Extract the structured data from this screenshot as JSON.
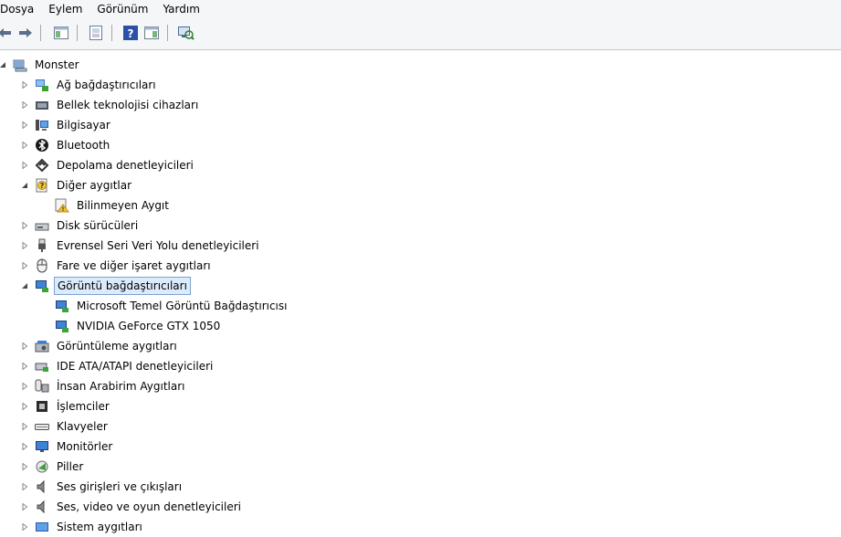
{
  "menubar": {
    "items": [
      "Dosya",
      "Eylem",
      "Görünüm",
      "Yardım"
    ]
  },
  "toolbar": {
    "buttons": [
      "back-arrow-icon",
      "forward-arrow-icon",
      "console-tree-icon",
      "properties-icon",
      "help-icon",
      "action-pane-icon",
      "scan-hardware-icon"
    ]
  },
  "tree": {
    "root": "Monster",
    "categories": [
      {
        "label": "Ağ bağdaştırıcıları",
        "icon": "network-adapter-icon",
        "expanded": false
      },
      {
        "label": "Bellek teknolojisi cihazları",
        "icon": "memory-device-icon",
        "expanded": false
      },
      {
        "label": "Bilgisayar",
        "icon": "computer-icon",
        "expanded": false
      },
      {
        "label": "Bluetooth",
        "icon": "bluetooth-icon",
        "expanded": false
      },
      {
        "label": "Depolama denetleyicileri",
        "icon": "storage-controller-icon",
        "expanded": false
      },
      {
        "label": "Diğer aygıtlar",
        "icon": "other-devices-icon",
        "expanded": true,
        "children": [
          {
            "label": "Bilinmeyen Aygıt",
            "icon": "unknown-device-warning-icon"
          }
        ]
      },
      {
        "label": "Disk sürücüleri",
        "icon": "disk-drive-icon",
        "expanded": false
      },
      {
        "label": "Evrensel Seri Veri Yolu denetleyicileri",
        "icon": "usb-icon",
        "expanded": false
      },
      {
        "label": "Fare ve diğer işaret aygıtları",
        "icon": "mouse-icon",
        "expanded": false
      },
      {
        "label": "Görüntü bağdaştırıcıları",
        "icon": "display-adapter-icon",
        "expanded": true,
        "selected": true,
        "children": [
          {
            "label": "Microsoft Temel Görüntü Bağdaştırıcısı",
            "icon": "display-adapter-icon"
          },
          {
            "label": "NVIDIA GeForce GTX 1050",
            "icon": "display-adapter-icon"
          }
        ]
      },
      {
        "label": "Görüntüleme aygıtları",
        "icon": "imaging-device-icon",
        "expanded": false
      },
      {
        "label": "IDE ATA/ATAPI denetleyicileri",
        "icon": "ide-controller-icon",
        "expanded": false
      },
      {
        "label": "İnsan Arabirim Aygıtları",
        "icon": "hid-icon",
        "expanded": false
      },
      {
        "label": "İşlemciler",
        "icon": "processor-icon",
        "expanded": false
      },
      {
        "label": "Klavyeler",
        "icon": "keyboard-icon",
        "expanded": false
      },
      {
        "label": "Monitörler",
        "icon": "monitor-icon",
        "expanded": false
      },
      {
        "label": "Piller",
        "icon": "battery-icon",
        "expanded": false
      },
      {
        "label": "Ses girişleri ve çıkışları",
        "icon": "speaker-icon",
        "expanded": false
      },
      {
        "label": "Ses, video ve oyun denetleyicileri",
        "icon": "speaker-icon",
        "expanded": false
      },
      {
        "label": "Sistem aygıtları",
        "icon": "system-device-icon",
        "expanded": false
      }
    ]
  }
}
